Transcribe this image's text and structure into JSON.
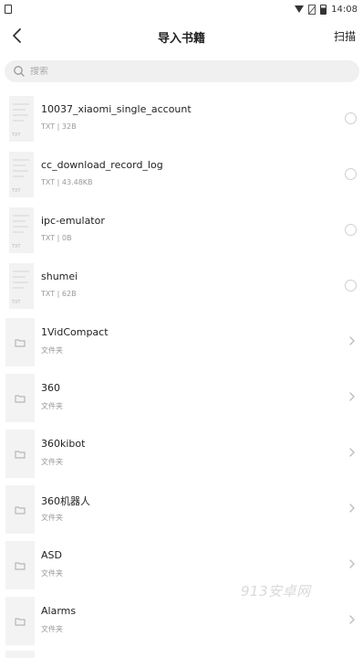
{
  "status_bar": {
    "time": "14:08"
  },
  "header": {
    "title": "导入书籍",
    "scan_label": "扫描"
  },
  "search": {
    "placeholder": "搜索"
  },
  "files": [
    {
      "name": "10037_xiaomi_single_account",
      "type": "TXT",
      "size": "32B",
      "thumb_tag": "TXT"
    },
    {
      "name": "cc_download_record_log",
      "type": "TXT",
      "size": "43.48KB",
      "thumb_tag": "TXT"
    },
    {
      "name": "ipc-emulator",
      "type": "TXT",
      "size": "0B",
      "thumb_tag": "TXT"
    },
    {
      "name": "shumei",
      "type": "TXT",
      "size": "62B",
      "thumb_tag": "TXT"
    }
  ],
  "folders": [
    {
      "name": "1VidCompact",
      "label": "文件夹"
    },
    {
      "name": "360",
      "label": "文件夹"
    },
    {
      "name": "360kibot",
      "label": "文件夹"
    },
    {
      "name": "360机器人",
      "label": "文件夹"
    },
    {
      "name": "ASD",
      "label": "文件夹"
    },
    {
      "name": "Alarms",
      "label": "文件夹"
    }
  ],
  "watermark": "913安卓网"
}
